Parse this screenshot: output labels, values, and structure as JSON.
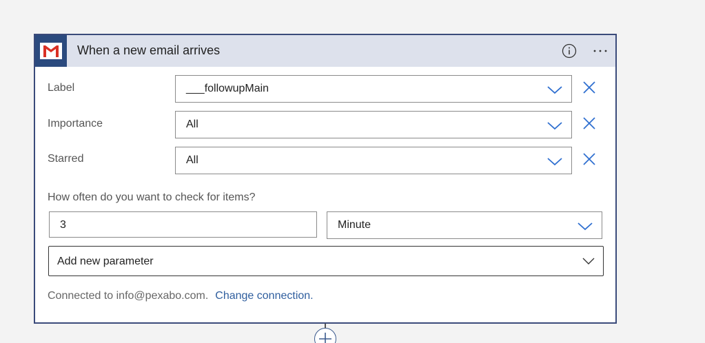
{
  "card": {
    "title": "When a new email arrives",
    "icon": "gmail-icon"
  },
  "fields": [
    {
      "label": "Label",
      "value": "___followupMain"
    },
    {
      "label": "Importance",
      "value": "All"
    },
    {
      "label": "Starred",
      "value": "All"
    }
  ],
  "recurrence": {
    "question": "How often do you want to check for items?",
    "interval": "3",
    "frequency": "Minute"
  },
  "add_parameter": {
    "placeholder": "Add new parameter"
  },
  "connection": {
    "text": "Connected to info@pexabo.com.",
    "link": "Change connection."
  },
  "colors": {
    "header_bg": "#dde1ec",
    "icon_bg": "#2b4a7e",
    "accent": "#2f6fd0",
    "gmail_red": "#d93025",
    "link": "#2f5e9e"
  }
}
